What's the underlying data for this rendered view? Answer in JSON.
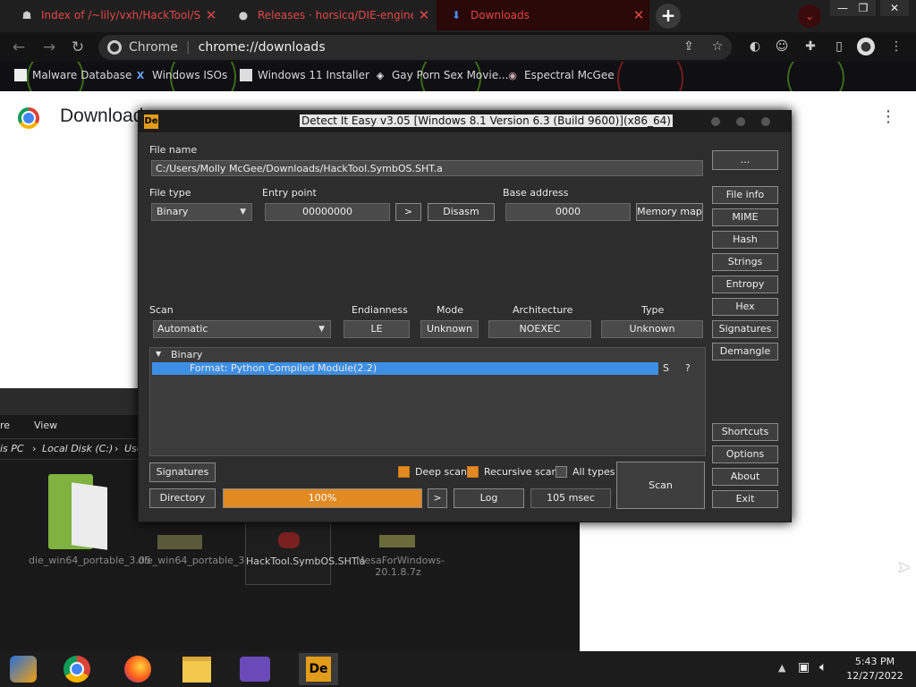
{
  "browser": {
    "tabs": [
      {
        "title": "Index of /~lily/vxh/HackTool/Sy",
        "active": false
      },
      {
        "title": "Releases · horsicq/DIE-engine",
        "active": false
      },
      {
        "title": "Downloads",
        "active": true
      }
    ],
    "new_tab_label": "+",
    "site_label": "Chrome",
    "url": "chrome://downloads",
    "bookmarks": [
      {
        "label": "Malware Database"
      },
      {
        "label": "Windows ISOs"
      },
      {
        "label": "Windows 11 Installer"
      },
      {
        "label": "Gay Porn Sex Movie..."
      },
      {
        "label": "Espectral McGee"
      }
    ]
  },
  "downloads_page": {
    "title": "Downloads"
  },
  "explorer": {
    "menu": [
      "re",
      "View"
    ],
    "breadcrumb": [
      "is PC",
      "Local Disk (C:)",
      "Use"
    ],
    "files": [
      {
        "name": "die_win64_portable_3.05",
        "icon": "folder-icon"
      },
      {
        "name": "die_win64_portable_3.05.zip",
        "icon": "zip-icon"
      },
      {
        "name": "HackTool.SymbOS.SHT.a",
        "icon": "file-icon"
      },
      {
        "name": "MesaForWindows-20.1.8.7z",
        "icon": "archive-icon"
      }
    ]
  },
  "die": {
    "window_title": "Detect It Easy v3.05 [Windows 8.1 Version 6.3 (Build 9600)](x86_64)",
    "logo_text": "De",
    "file_name_label": "File name",
    "file_name": "C:/Users/Molly McGee/Downloads/HackTool.SymbOS.SHT.a",
    "browse_label": "...",
    "file_type_label": "File type",
    "file_type": "Binary",
    "entry_point_label": "Entry point",
    "entry_point": "00000000",
    "go_label": ">",
    "disasm_label": "Disasm",
    "base_address_label": "Base address",
    "base_address": "0000",
    "memory_map_label": "Memory map",
    "side_buttons": [
      "File info",
      "MIME",
      "Hash",
      "Strings",
      "Entropy",
      "Hex",
      "Signatures",
      "Demangle"
    ],
    "scan_label": "Scan",
    "scan_mode": "Automatic",
    "endianness_label": "Endianness",
    "endianness": "LE",
    "mode_label": "Mode",
    "mode": "Unknown",
    "architecture_label": "Architecture",
    "architecture": "NOEXEC",
    "type_label": "Type",
    "type": "Unknown",
    "result_group": "Binary",
    "result_format": "Format: Python Compiled Module(2.2)",
    "result_flag": "S",
    "result_info": "?",
    "signatures_label": "Signatures",
    "directory_label": "Directory",
    "deep_scan_label": "Deep scan",
    "deep_scan": true,
    "recursive_scan_label": "Recursive scan",
    "recursive_scan": true,
    "all_types_label": "All types",
    "all_types": false,
    "progress_text": "100%",
    "progress_value": 100,
    "more_label": ">",
    "log_label": "Log",
    "elapsed": "105 msec",
    "scan_button_label": "Scan",
    "bottom_buttons": [
      "Shortcuts",
      "Options",
      "About",
      "Exit"
    ]
  },
  "taskbar": {
    "time": "5:43 PM",
    "date": "12/27/2022"
  },
  "colors": {
    "accent_orange": "#e28a21",
    "selection_blue": "#3d8fe6",
    "tab_red": "#e04848"
  }
}
